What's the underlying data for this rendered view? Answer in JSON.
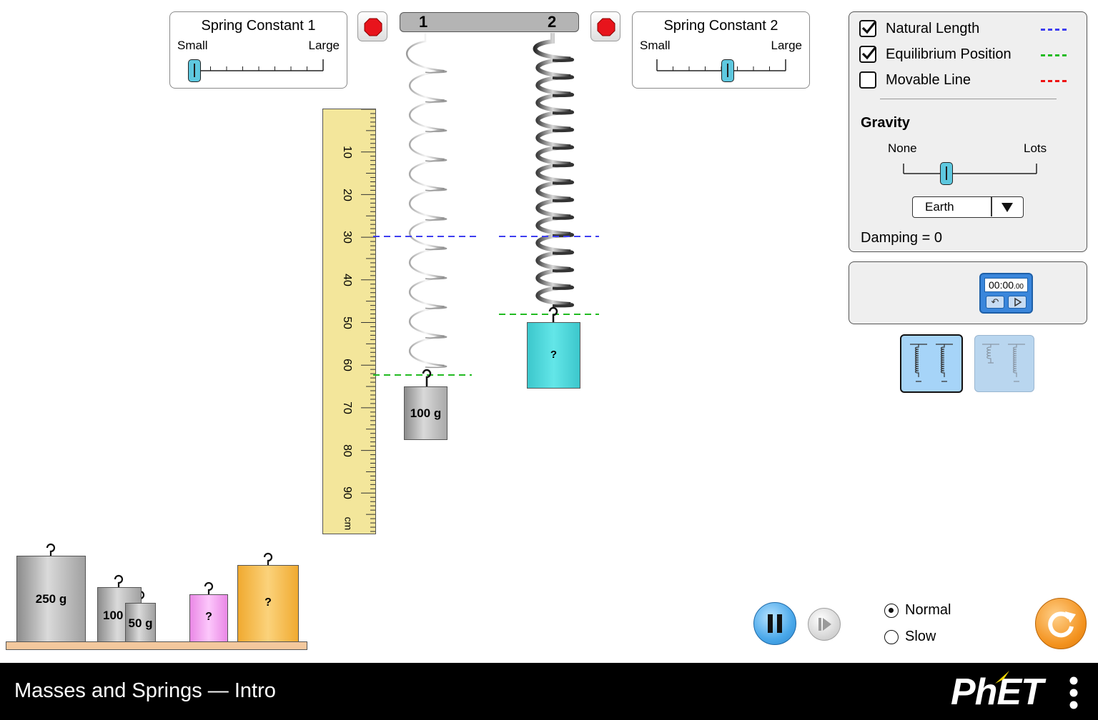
{
  "spring_controls": {
    "spring1": {
      "title": "Spring Constant 1",
      "small_label": "Small",
      "large_label": "Large",
      "level": 0.0
    },
    "spring2": {
      "title": "Spring Constant 2",
      "small_label": "Small",
      "large_label": "Large",
      "level": 0.5
    }
  },
  "spring_numbers": {
    "spring1": "1",
    "spring2": "2"
  },
  "ruler": {
    "ticks": [
      "10",
      "20",
      "30",
      "40",
      "50",
      "60",
      "70",
      "80",
      "90"
    ],
    "unit": "cm"
  },
  "hanging_masses": {
    "spring1_mass": "100 g",
    "spring2_mass": "?"
  },
  "shelf_masses": {
    "m250": "250 g",
    "m100": "100",
    "m50": "50 g",
    "pink": "?",
    "orange": "?"
  },
  "settings": {
    "natural_length": {
      "label": "Natural Length",
      "checked": true,
      "color": "#3e3ef0"
    },
    "equilibrium_position": {
      "label": "Equilibrium Position",
      "checked": true,
      "color": "#22bb22"
    },
    "movable_line": {
      "label": "Movable Line",
      "checked": false,
      "color": "#ee1111"
    },
    "gravity": {
      "title": "Gravity",
      "none_label": "None",
      "lots_label": "Lots",
      "level": 0.33,
      "selected": "Earth"
    },
    "damping_text": "Damping = 0"
  },
  "stopwatch": {
    "time": "00:00",
    "hundredths": ".00"
  },
  "playback": {
    "normal_label": "Normal",
    "slow_label": "Slow",
    "selected": "Normal"
  },
  "navbar": {
    "title": "Masses and Springs — Intro",
    "brand": "PhET"
  },
  "colors": {
    "accent": "#5ec8df",
    "ruler": "#f3e69b",
    "teal_mass": "#4dd9dc",
    "pink_mass": "#f4a6f2",
    "orange_mass": "#f6bb48",
    "shelf": "#f3c89d",
    "reset": "#f3921e"
  }
}
